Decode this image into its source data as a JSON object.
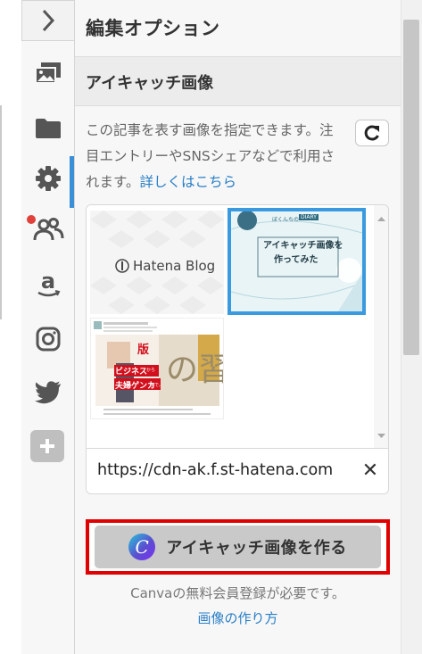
{
  "panel": {
    "title": "編集オプション",
    "section_title": "アイキャッチ画像"
  },
  "eyecatch": {
    "description": "この記事を表す画像を指定できます。注目エントリーやSNSシェアなどで利用されます。",
    "details_link": "詳しくはこちら",
    "thumbnails": [
      {
        "label": "Hatena Blog",
        "selected": false
      },
      {
        "title_line1": "アイキャッチ画像を",
        "title_line2": "作ってみた",
        "tag1": "ぼくんちの",
        "tag2": "DIARY",
        "selected": true
      },
      {
        "text1": "ビジネス",
        "text2": "から",
        "text3": "夫婦ゲンカ",
        "text4": "まで。",
        "text5": "の習",
        "text6": "版",
        "selected": false
      }
    ],
    "url_value": "https://cdn-ak.f.st-hatena.com",
    "clear_symbol": "✕"
  },
  "canva": {
    "logo_letter": "C",
    "button_label": "アイキャッチ画像を作る",
    "note": "Canvaの無料会員登録が必要です。",
    "howto_link": "画像の作り方"
  },
  "colors": {
    "accent": "#3a8fd6",
    "link": "#2a7fc7",
    "highlight": "#e10000",
    "notification": "#e0413a"
  },
  "rail": {
    "icons": [
      "chevron-right-icon",
      "image-icon",
      "folder-icon",
      "gear-icon",
      "people-icon",
      "amazon-icon",
      "instagram-icon",
      "twitter-icon",
      "plus-icon"
    ]
  }
}
